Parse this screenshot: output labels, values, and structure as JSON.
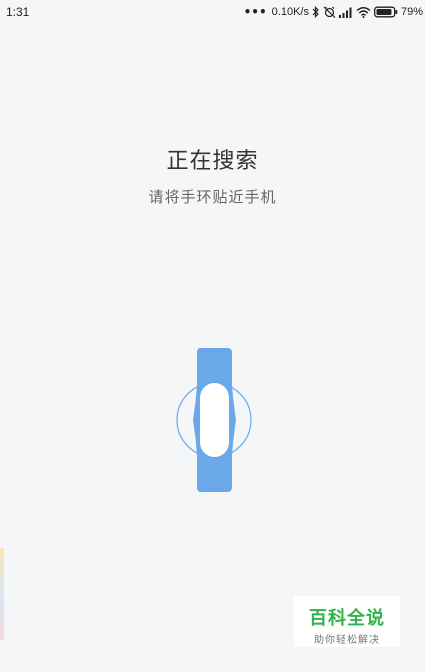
{
  "status_bar": {
    "time": "1:31",
    "dots": "•••",
    "network_speed": "0.10K/s",
    "battery_percent": "79%",
    "icons": [
      "bluetooth-icon",
      "alarm-off-icon",
      "signal-icon",
      "wifi-icon",
      "battery-icon"
    ]
  },
  "main": {
    "title": "正在搜索",
    "subtitle": "请将手环贴近手机"
  },
  "illustration": {
    "name": "wristband-icon",
    "band_color": "#6aa8ea",
    "ring_color": "#6aa8ea"
  },
  "watermark": {
    "title": "百科全说",
    "subtitle": "助你轻松解决",
    "color": "#2fb34a"
  }
}
